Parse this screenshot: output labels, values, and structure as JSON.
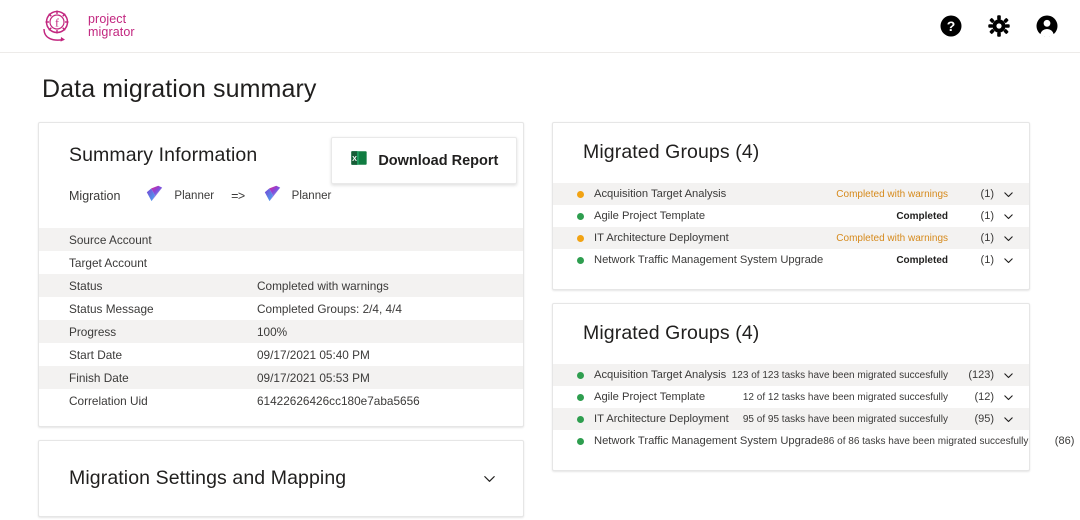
{
  "header": {
    "brand": {
      "line1": "project",
      "line2": "migrator",
      "icon": "project-migrator-logo"
    },
    "actions": [
      {
        "name": "help-icon",
        "label": "Help"
      },
      {
        "name": "settings-gear-icon",
        "label": "Settings"
      },
      {
        "name": "account-icon",
        "label": "Account"
      }
    ]
  },
  "page": {
    "title": "Data migration summary"
  },
  "summary": {
    "title": "Summary Information",
    "migration_label": "Migration",
    "source_app": "Planner",
    "target_app": "Planner",
    "arrow": "=>",
    "download_button": {
      "label": "Download Report",
      "icon": "excel-icon"
    },
    "rows": [
      {
        "key": "Source Account",
        "value": ""
      },
      {
        "key": "Target Account",
        "value": ""
      },
      {
        "key": "Status",
        "value": "Completed with warnings"
      },
      {
        "key": "Status Message",
        "value": "Completed Groups: 2/4, 4/4"
      },
      {
        "key": "Progress",
        "value": "100%"
      },
      {
        "key": "Start Date",
        "value": "09/17/2021 05:40 PM"
      },
      {
        "key": "Finish Date",
        "value": "09/17/2021 05:53 PM"
      },
      {
        "key": "Correlation Uid",
        "value": "61422626426cc180e7aba5656"
      }
    ]
  },
  "settings_card": {
    "title": "Migration Settings and Mapping",
    "chevron": "chevron-down-icon"
  },
  "groups_status": {
    "title": "Migrated Groups (4)",
    "rows": [
      {
        "name": "Acquisition Target Analysis",
        "status": "Completed with warnings",
        "status_type": "warn",
        "count": "(1)",
        "dot": "#f2a313"
      },
      {
        "name": "Agile Project Template",
        "status": "Completed",
        "status_type": "ok",
        "count": "(1)",
        "dot": "#2e9e4f"
      },
      {
        "name": "IT Architecture Deployment",
        "status": "Completed with warnings",
        "status_type": "warn",
        "count": "(1)",
        "dot": "#f2a313"
      },
      {
        "name": "Network Traffic Management System Upgrade",
        "status": "Completed",
        "status_type": "ok",
        "count": "(1)",
        "dot": "#2e9e4f"
      }
    ]
  },
  "groups_tasks": {
    "title": "Migrated Groups (4)",
    "rows": [
      {
        "name": "Acquisition Target Analysis",
        "status": "123 of 123 tasks have been migrated succesfully",
        "count": "(123)",
        "dot": "#2e9e4f"
      },
      {
        "name": "Agile Project Template",
        "status": "12 of 12 tasks have been migrated succesfully",
        "count": "(12)",
        "dot": "#2e9e4f"
      },
      {
        "name": "IT Architecture Deployment",
        "status": "95 of 95 tasks have been migrated succesfully",
        "count": "(95)",
        "dot": "#2e9e4f"
      },
      {
        "name": "Network Traffic Management System Upgrade",
        "status": "86 of 86 tasks have been migrated succesfully",
        "count": "(86)",
        "dot": "#2e9e4f"
      }
    ]
  },
  "colors": {
    "brand": "#c2267f",
    "warning": "#d68a1c",
    "success": "#2e9e4f",
    "warning_dot": "#f2a313",
    "excel_green": "#1d7044",
    "row_stripe": "#f3f2f1"
  }
}
